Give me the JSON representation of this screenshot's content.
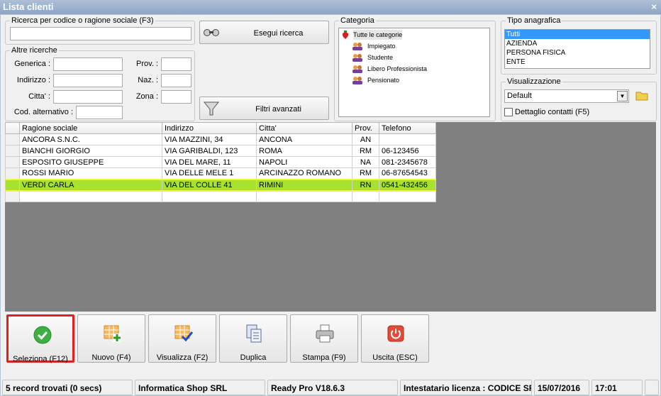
{
  "window": {
    "title": "Lista clienti",
    "close_label": "×"
  },
  "search": {
    "legend": "Ricerca per codice o ragione sociale (F3)",
    "value": "",
    "run_label": "Esegui ricerca"
  },
  "other": {
    "legend": "Altre ricerche",
    "generica": "Generica :",
    "indirizzo": "Indirizzo :",
    "citta": "Citta' :",
    "cod_alt": "Cod. alternativo :",
    "prov": "Prov. :",
    "naz": "Naz. :",
    "zona": "Zona :",
    "filters_label": "Filtri avanzati"
  },
  "category": {
    "legend": "Categoria",
    "root": "Tutte le categorie",
    "items": [
      "Impiegato",
      "Studente",
      "Libero Professionista",
      "Pensionato"
    ]
  },
  "tipo": {
    "legend": "Tipo anagrafica",
    "options": [
      "Tutti",
      "AZIENDA",
      "PERSONA FISICA",
      "ENTE"
    ],
    "selected": "Tutti"
  },
  "view": {
    "legend": "Visualizzazione",
    "value": "Default",
    "details_label": "Dettaglio contatti (F5)"
  },
  "grid": {
    "columns": [
      "Ragione sociale",
      "Indirizzo",
      "Citta'",
      "Prov.",
      "Telefono"
    ],
    "rows": [
      [
        "ANCORA S.N.C.",
        "VIA MAZZINI, 34",
        "ANCONA",
        "AN",
        ""
      ],
      [
        "BIANCHI GIORGIO",
        "VIA GARIBALDI, 123",
        "ROMA",
        "RM",
        "06-123456"
      ],
      [
        "ESPOSITO GIUSEPPE",
        "VIA DEL MARE, 11",
        "NAPOLI",
        "NA",
        "081-2345678"
      ],
      [
        "ROSSI MARIO",
        "VIA DELLE MELE 1",
        "ARCINAZZO ROMANO",
        "RM",
        "06-87654543"
      ],
      [
        "VERDI CARLA",
        "VIA DEL COLLE 41",
        "RIMINI",
        "RN",
        "0541-432456"
      ]
    ],
    "highlighted_row": 4,
    "highlight_color": "#a6e22e"
  },
  "toolbar": {
    "select": "Seleziona (F12)",
    "new": "Nuovo (F4)",
    "view": "Visualizza (F2)",
    "duplicate": "Duplica",
    "print": "Stampa (F9)",
    "exit": "Uscita (ESC)"
  },
  "status": {
    "records": "5 record trovati (0 secs)",
    "company": "Informatica Shop SRL",
    "version": "Ready Pro V18.6.3",
    "license": "Intestatario licenza : CODICE SRL",
    "date": "15/07/2016",
    "time": "17:01"
  },
  "colors": {
    "focus_border": "#e02020",
    "selection": "#3399ff"
  }
}
